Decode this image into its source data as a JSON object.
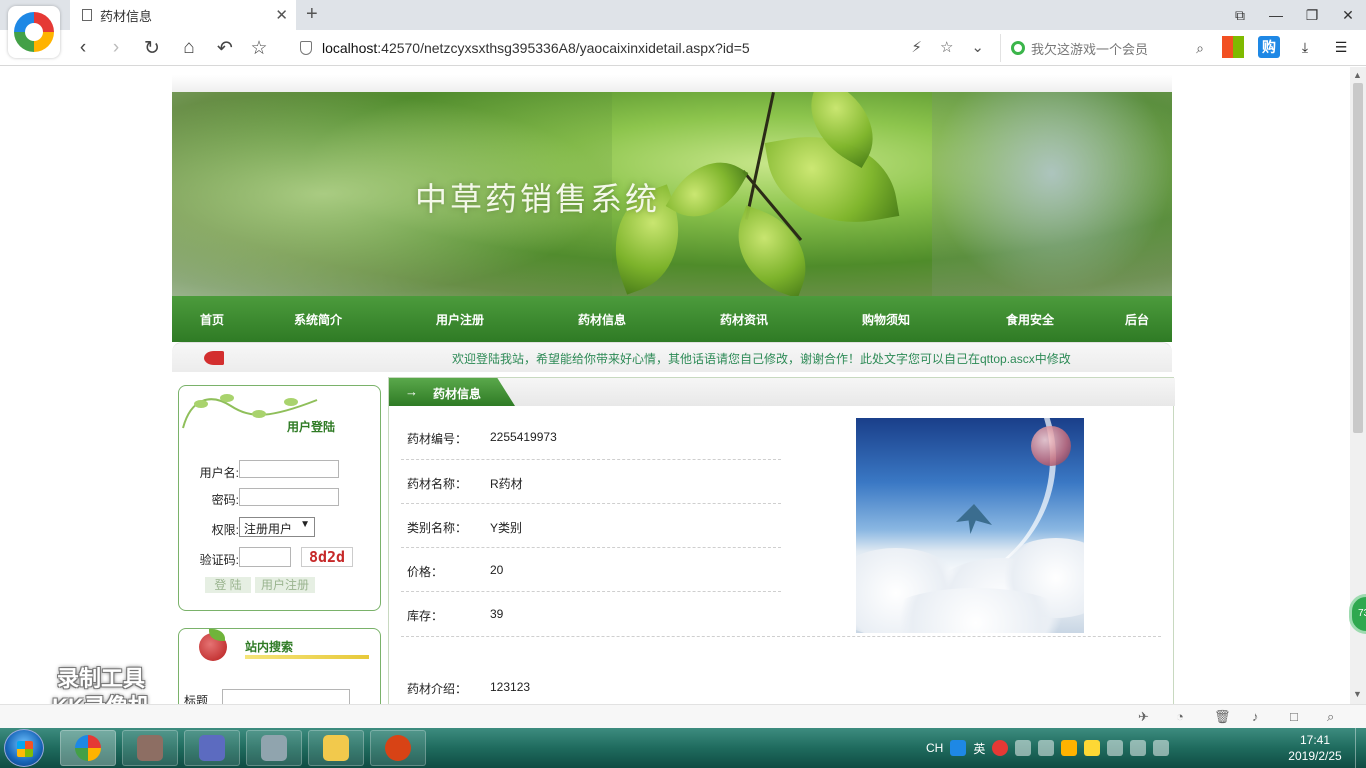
{
  "browser": {
    "tab_title": "药材信息",
    "new_tab": "+",
    "url_host": "localhost",
    "url_rest": ":42570/netzcyxsxthsg395336A8/yaocaixinxidetail.aspx?id=5",
    "search_placeholder": "我欠这游戏一个会员",
    "window_buttons": [
      "⧉",
      "—",
      "❐",
      "✕"
    ]
  },
  "site": {
    "banner_title": "中草药销售系统",
    "nav": [
      "首页",
      "系统简介",
      "用户注册",
      "药材信息",
      "药材资讯",
      "购物须知",
      "食用安全",
      "后台"
    ],
    "marquee": "欢迎登陆我站，希望能给你带来好心情，其他话语请您自己修改，谢谢合作！此处文字您可以自己在qttop.ascx中修改"
  },
  "login": {
    "title": "用户登陆",
    "username_label": "用户名:",
    "password_label": "密码:",
    "role_label": "权限:",
    "role_selected": "注册用户",
    "captcha_label": "验证码:",
    "captcha_code": "8d2d",
    "login_button": "登 陆",
    "register_button": "用户注册"
  },
  "site_search": {
    "title": "站内搜索",
    "field_label": "标题"
  },
  "detail": {
    "section_title": "药材信息",
    "rows": [
      {
        "label": "药材编号：",
        "value": "2255419973"
      },
      {
        "label": "药材名称：",
        "value": "R药材"
      },
      {
        "label": "类别名称：",
        "value": "Y类别"
      },
      {
        "label": "价格：",
        "value": "20"
      },
      {
        "label": "库存：",
        "value": "39"
      }
    ],
    "intro_label": "药材介绍：",
    "intro_value": "123123"
  },
  "overlay": {
    "watermark_line1": "录制工具",
    "watermark_line2": "KK录像机",
    "float_badge": "73"
  },
  "taskbar": {
    "lang": "CH",
    "ime": "英",
    "time": "17:41",
    "date": "2019/2/25"
  },
  "colors": {
    "nav_green": "#2f7b25",
    "accent_green": "#4c9b3c",
    "marquee_text": "#2e8b57"
  }
}
